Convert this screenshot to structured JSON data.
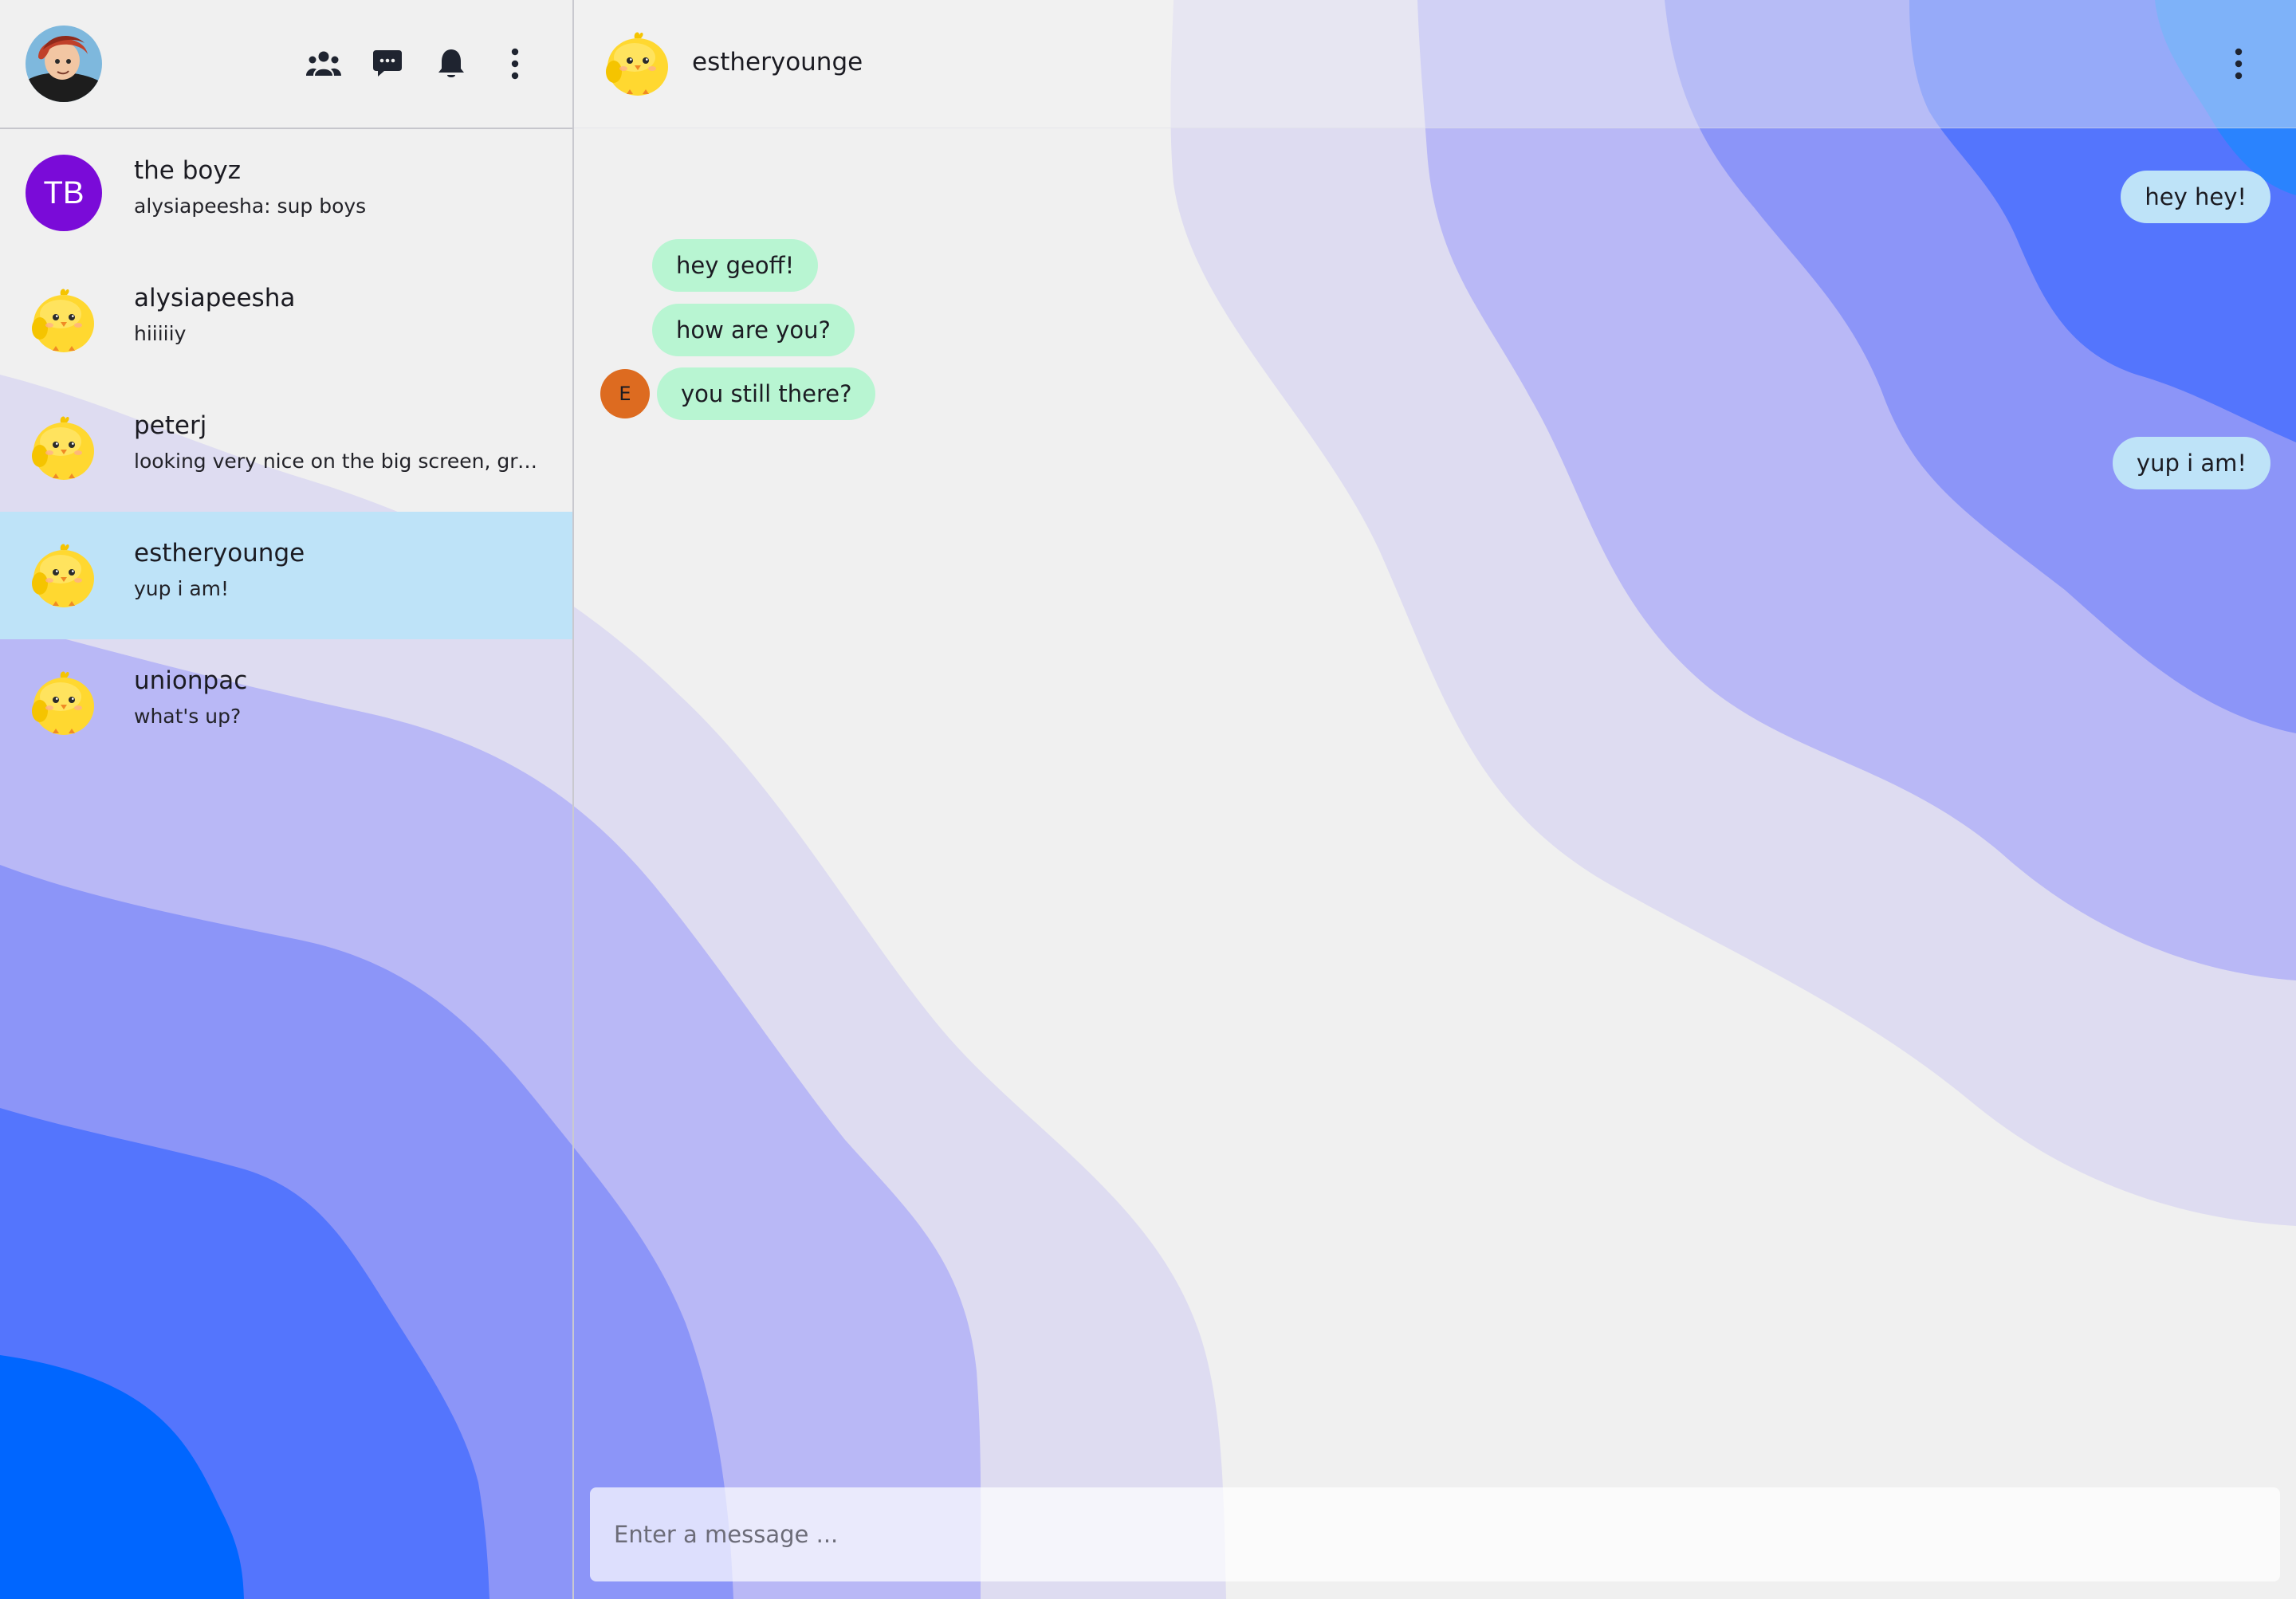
{
  "sidebar": {
    "header": {
      "user_avatar": "user-profile-avatar",
      "icons": [
        "groups-icon",
        "chat-bubble-icon",
        "bell-icon",
        "more-vertical-icon"
      ]
    },
    "chats": [
      {
        "name": "the boyz",
        "preview": "alysiapeesha: sup boys",
        "avatar_type": "initials",
        "initials": "TB",
        "avatar_color": "#7a0bd8",
        "selected": false
      },
      {
        "name": "alysiapeesha",
        "preview": "hiiiiiy",
        "avatar_type": "chick-icon",
        "selected": false
      },
      {
        "name": "peterj",
        "preview": "looking very nice on the big screen, grea...",
        "avatar_type": "chick-icon",
        "selected": false
      },
      {
        "name": "estheryounge",
        "preview": "yup i am!",
        "avatar_type": "chick-icon",
        "selected": true
      },
      {
        "name": "unionpac",
        "preview": "what's up?",
        "avatar_type": "chick-icon",
        "selected": false
      }
    ]
  },
  "chat": {
    "peer_name": "estheryounge",
    "messages": [
      {
        "text": "hey hey!",
        "direction": "out"
      },
      {
        "text": "hey geoff!",
        "direction": "in"
      },
      {
        "text": "how are you?",
        "direction": "in"
      },
      {
        "text": "you still there?",
        "direction": "in",
        "sender_initial": "E"
      },
      {
        "text": "yup i am!",
        "direction": "out"
      }
    ],
    "composer_placeholder": "Enter a message ..."
  },
  "colors": {
    "incoming_bubble": "#b8f5d2",
    "outgoing_bubble": "#bee3f8",
    "selected_chat": "#bee3f8",
    "group_avatar": "#7a0bd8",
    "sender_avatar": "#dd6b20",
    "wave_1": "#dedcf1",
    "wave_2": "#b9b8f6",
    "wave_3": "#8c95f8",
    "wave_4": "#5475fd",
    "wave_5": "#0066ff"
  }
}
